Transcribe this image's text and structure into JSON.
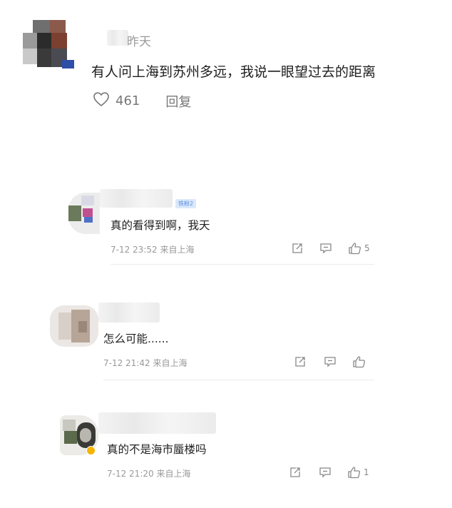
{
  "main_comment": {
    "username": "昨天",
    "text": "有人问上海到苏州多远，我说一眼望过去的距离",
    "likes": "461",
    "reply_label": "回复",
    "icon": "heart-icon"
  },
  "replies": [
    {
      "badge": "铁粉2",
      "text": "真的看得到啊，我天",
      "meta": "7-12 23:52 来自上海",
      "like_count": "5"
    },
    {
      "text": "怎么可能......",
      "meta": "7-12 21:42 来自上海",
      "like_count": ""
    },
    {
      "text": "真的不是海市蜃楼吗",
      "meta": "7-12 21:20 来自上海",
      "like_count": "1"
    }
  ],
  "icons": {
    "share": "share-icon",
    "comment": "comment-icon",
    "like": "thumb-up-icon"
  },
  "colors": {
    "text_main": "#1e1e1e",
    "meta_gray": "#999999",
    "badge_blue": "#5b8fdc",
    "verified_gold": "#f5b400"
  }
}
